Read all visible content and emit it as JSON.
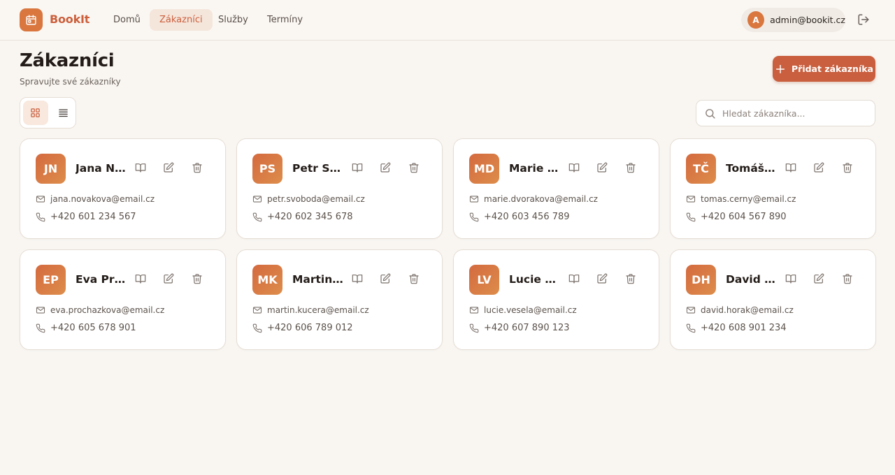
{
  "app": {
    "brand": "BookIt",
    "nav": [
      {
        "label": "Domů",
        "active": false
      },
      {
        "label": "Zákazníci",
        "active": true
      },
      {
        "label": "Služby",
        "active": false
      },
      {
        "label": "Termíny",
        "active": false
      }
    ],
    "user": {
      "initial": "A",
      "email": "admin@bookit.cz"
    }
  },
  "page": {
    "title": "Zákazníci",
    "subtitle": "Spravujte své zákazníky",
    "add_button": "Přidat zákazníka",
    "search_placeholder": "Hledat zákazníka...",
    "view_mode": "grid"
  },
  "colors": {
    "accent": "#c95f3e",
    "avatar": "#d9773f",
    "background": "#f9f6f2"
  },
  "customers": [
    {
      "initials": "JN",
      "name": "Jana No...",
      "email": "jana.novakova@email.cz",
      "phone": "+420 601 234 567"
    },
    {
      "initials": "PS",
      "name": "Petr Sv...",
      "email": "petr.svoboda@email.cz",
      "phone": "+420 602 345 678"
    },
    {
      "initials": "MD",
      "name": "Marie D...",
      "email": "marie.dvorakova@email.cz",
      "phone": "+420 603 456 789"
    },
    {
      "initials": "TČ",
      "name": "Tomáš ...",
      "email": "tomas.cerny@email.cz",
      "phone": "+420 604 567 890"
    },
    {
      "initials": "EP",
      "name": "Eva Pro...",
      "email": "eva.prochazkova@email.cz",
      "phone": "+420 605 678 901"
    },
    {
      "initials": "MK",
      "name": "Martin ...",
      "email": "martin.kucera@email.cz",
      "phone": "+420 606 789 012"
    },
    {
      "initials": "LV",
      "name": "Lucie Ve...",
      "email": "lucie.vesela@email.cz",
      "phone": "+420 607 890 123"
    },
    {
      "initials": "DH",
      "name": "David H...",
      "email": "david.horak@email.cz",
      "phone": "+420 608 901 234"
    }
  ],
  "icons": {
    "logo": "calendar-icon",
    "logout": "logout-icon",
    "add": "plus-icon",
    "grid_view": "grid-icon",
    "list_view": "list-icon",
    "search": "search-icon",
    "card_actions": [
      "book-icon",
      "edit-icon",
      "trash-icon"
    ],
    "email": "mail-icon",
    "phone": "phone-icon"
  }
}
